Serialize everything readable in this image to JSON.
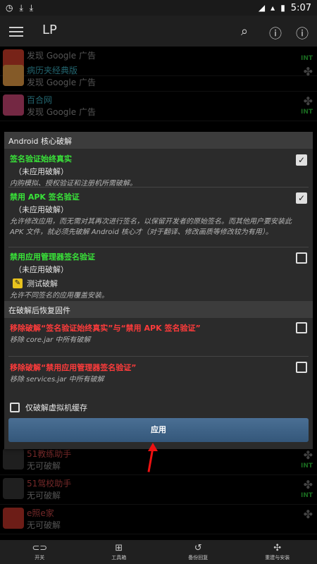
{
  "status_bar": {
    "left_icons": [
      "clock-icon",
      "download-icon",
      "download-icon"
    ],
    "right_icons": [
      "wifi-icon",
      "signal-icon",
      "battery-icon"
    ],
    "time": "5:07"
  },
  "app_bar": {
    "title": "LP",
    "actions": [
      "search-icon",
      "help-icon",
      "info-icon"
    ]
  },
  "app_list": [
    {
      "name": "",
      "desc": "发现 Google 广告",
      "badge": "INT",
      "icon_color": "#d9412c"
    },
    {
      "name": "病历夹经典版",
      "desc": "发现 Google 广告",
      "badge": "",
      "icon_color": "#f0a54a"
    },
    {
      "name": "百合网",
      "desc": "发现 Google 广告",
      "badge": "INT",
      "icon_color": "#d44a7a"
    },
    {
      "name": "51教练助手",
      "desc": "无可破解",
      "badge": "INT",
      "icon_color": "#444"
    },
    {
      "name": "51驾校助手",
      "desc": "无可破解",
      "badge": "INT",
      "icon_color": "#444"
    },
    {
      "name": "e照e家",
      "desc": "无可破解",
      "badge": "",
      "icon_color": "#c7352b"
    }
  ],
  "dialog": {
    "section1": "Android 核心破解",
    "opt1": {
      "title": "签名验证始终真实",
      "status": "（未应用破解）",
      "desc": "内购模拟、授权验证和注册机所需破解。",
      "checked": true
    },
    "opt2": {
      "title": "禁用 APK 签名验证",
      "status": "（未应用破解）",
      "desc": "允许修改应用，而无需对其再次进行签名，以保留开发者的原始签名。而其他用户要安装此 APK 文件，就必须先破解 Android 核心才（对于翻译、修改画质等修改较为有用）。",
      "checked": true
    },
    "opt3": {
      "title": "禁用应用管理器签名验证",
      "status": "（未应用破解）",
      "test_label": "测试破解",
      "desc": "允许不同签名的应用覆盖安装。",
      "checked": false
    },
    "section2": "在破解后恢复固件",
    "opt4": {
      "title": "移除破解“签名验证始终真实”与“禁用 APK 签名验证”",
      "desc": "移除 core.jar 中所有破解",
      "checked": false
    },
    "opt5": {
      "title": "移除破解“禁用应用管理器签名验证”",
      "desc": "移除 services.jar 中所有破解",
      "checked": false
    },
    "vm_label": "仅破解虚拟机缓存",
    "apply_label": "应用"
  },
  "bottom_nav": [
    {
      "icon": "toggle-icon",
      "label": "开关"
    },
    {
      "icon": "toolbox-icon",
      "label": "工具箱"
    },
    {
      "icon": "restore-icon",
      "label": "备份回复"
    },
    {
      "icon": "puzzle-icon",
      "label": "重建与安装"
    }
  ]
}
